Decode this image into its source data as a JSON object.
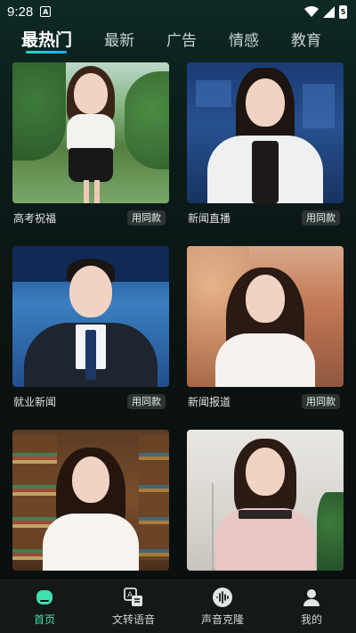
{
  "status_bar": {
    "time": "9:28",
    "notification_glyph": "A",
    "battery_glyph": "5"
  },
  "tabs": [
    {
      "label": "最热门",
      "active": true
    },
    {
      "label": "最新",
      "active": false
    },
    {
      "label": "广告",
      "active": false
    },
    {
      "label": "情感",
      "active": false
    },
    {
      "label": "教育",
      "active": false
    }
  ],
  "cards": [
    {
      "title": "高考祝福",
      "button": "用同款"
    },
    {
      "title": "新闻直播",
      "button": "用同款"
    },
    {
      "title": "就业新闻",
      "button": "用同款"
    },
    {
      "title": "新闻报道",
      "button": "用同款"
    },
    {
      "title": "",
      "button": ""
    },
    {
      "title": "",
      "button": ""
    }
  ],
  "bottom_nav": [
    {
      "label": "首页",
      "icon": "home-icon",
      "active": true
    },
    {
      "label": "文转语音",
      "icon": "text-to-speech-icon",
      "active": false
    },
    {
      "label": "声音克隆",
      "icon": "voice-clone-icon",
      "active": false
    },
    {
      "label": "我的",
      "icon": "profile-icon",
      "active": false
    }
  ],
  "colors": {
    "accent": "#3fe0b0",
    "tab_gradient_start": "#2fd6c0",
    "tab_gradient_end": "#25a7ff"
  }
}
